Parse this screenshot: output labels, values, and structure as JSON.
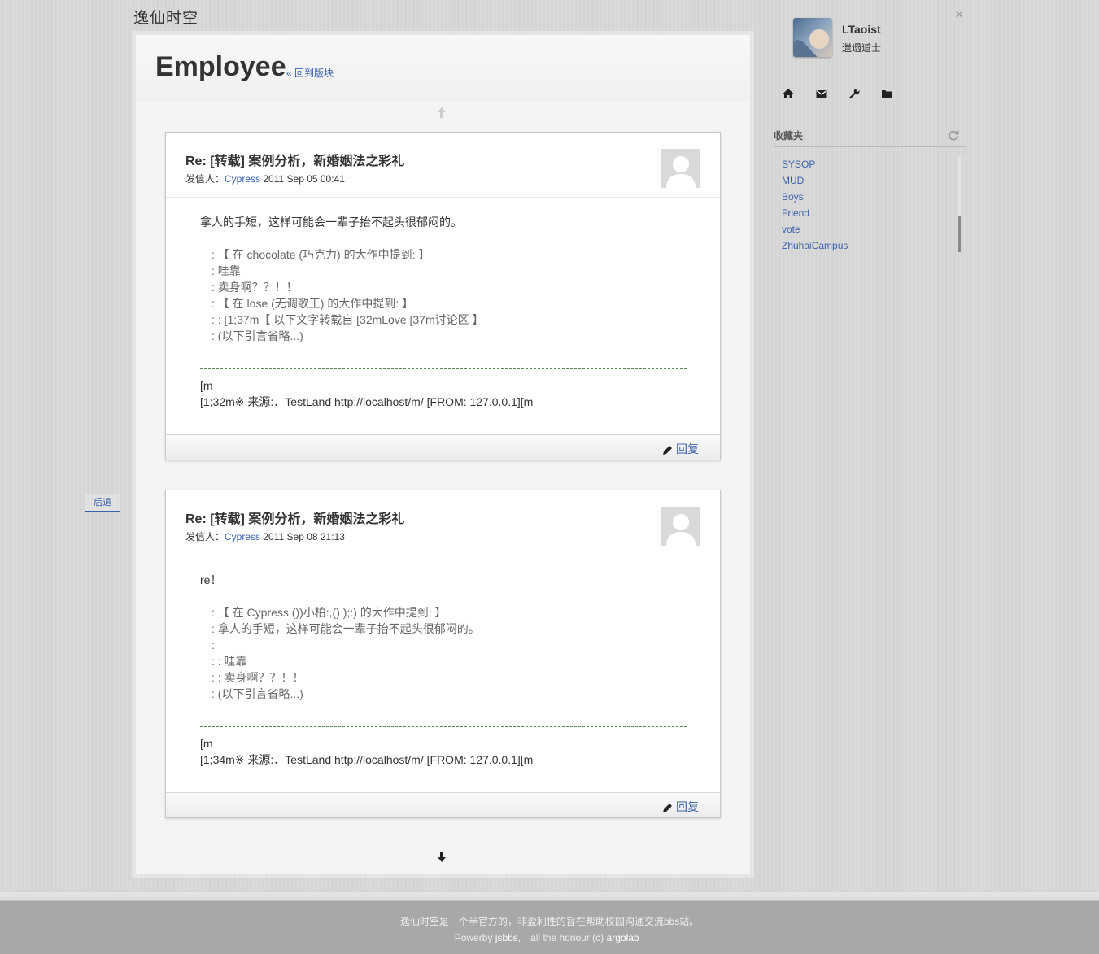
{
  "site": {
    "title": "逸仙时空"
  },
  "board": {
    "title": "Employee",
    "back_label": "« 回到版块"
  },
  "nav": {
    "back_label": "后退"
  },
  "posts": [
    {
      "title": "Re: [转载] 案例分析，新婚姻法之彩礼",
      "meta_prefix": "发信人：",
      "author": "Cypress",
      "date": "2011 Sep 05 00:41",
      "body": "拿人的手短，这样可能会一辈子抬不起头很郁闷的。",
      "quote": [
        ": 【 在 chocolate (巧克力) 的大作中提到: 】",
        ": 哇靠",
        ": 卖身啊？？！！",
        ": 【 在 lose (无调歌王) 的大作中提到: 】",
        ": : [1;37m【 以下文字转载自 [32mLove [37m讨论区 】",
        ": (以下引言省略...)"
      ],
      "sig1": "[m",
      "sig2": "[1;32m※ 来源:．TestLand http://localhost/m/ [FROM: 127.0.0.1][m",
      "reply_label": "回复"
    },
    {
      "title": "Re: [转载] 案例分析，新婚姻法之彩礼",
      "meta_prefix": "发信人：",
      "author": "Cypress",
      "date": "2011 Sep 08 21:13",
      "body": "re！",
      "quote": [
        ": 【 在 Cypress ())小柏:,() );:) 的大作中提到: 】",
        ": 拿人的手短，这样可能会一辈子抬不起头很郁闷的。",
        ":",
        ": : 哇靠",
        ": : 卖身啊？？！！",
        ": (以下引言省略...)"
      ],
      "sig1": "[m",
      "sig2": "[1;34m※ 来源:．TestLand http://localhost/m/ [FROM: 127.0.0.1][m",
      "reply_label": "回复"
    }
  ],
  "user": {
    "name": "LTaoist",
    "title": "邋遢道士"
  },
  "toolbar": {
    "icons": [
      "home-icon",
      "mail-icon",
      "wrench-icon",
      "folder-icon"
    ]
  },
  "favorites": {
    "title": "收藏夹",
    "items": [
      "SYSOP",
      "MUD",
      "Boys",
      "Friend",
      "vote",
      "ZhuhaiCampus"
    ]
  },
  "footer": {
    "line1": "逸仙时空是一个半官方的，非盈利性的旨在帮助校园沟通交流bbs站。",
    "powerby": "Powerby",
    "jsbbs": "jsbbs",
    "honour": ",　all the honour (c)",
    "argolab": "argolab",
    "end": "."
  },
  "colors": {
    "link": "#3b63ad",
    "sig_line": "#4f8a4f"
  }
}
